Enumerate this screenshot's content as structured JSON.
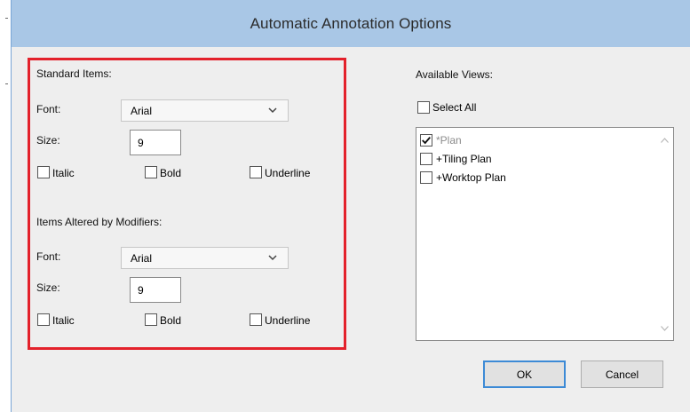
{
  "window": {
    "title": "Automatic Annotation Options"
  },
  "standard": {
    "heading": "Standard Items:",
    "font_label": "Font:",
    "font_value": "Arial",
    "size_label": "Size:",
    "size_value": "9",
    "italic": "Italic",
    "bold": "Bold",
    "underline": "Underline"
  },
  "modifiers": {
    "heading": "Items Altered by Modifiers:",
    "font_label": "Font:",
    "font_value": "Arial",
    "size_label": "Size:",
    "size_value": "9",
    "italic": "Italic",
    "bold": "Bold",
    "underline": "Underline"
  },
  "views": {
    "heading": "Available Views:",
    "select_all": "Select All",
    "items": [
      {
        "label": "*Plan",
        "checked": true
      },
      {
        "label": "+Tiling Plan",
        "checked": false
      },
      {
        "label": "+Worktop Plan",
        "checked": false
      }
    ]
  },
  "buttons": {
    "ok": "OK",
    "cancel": "Cancel"
  },
  "colors": {
    "titlebar": "#a9c7e6",
    "highlight": "#e3212b",
    "dialog_bg": "#eeeeee"
  }
}
